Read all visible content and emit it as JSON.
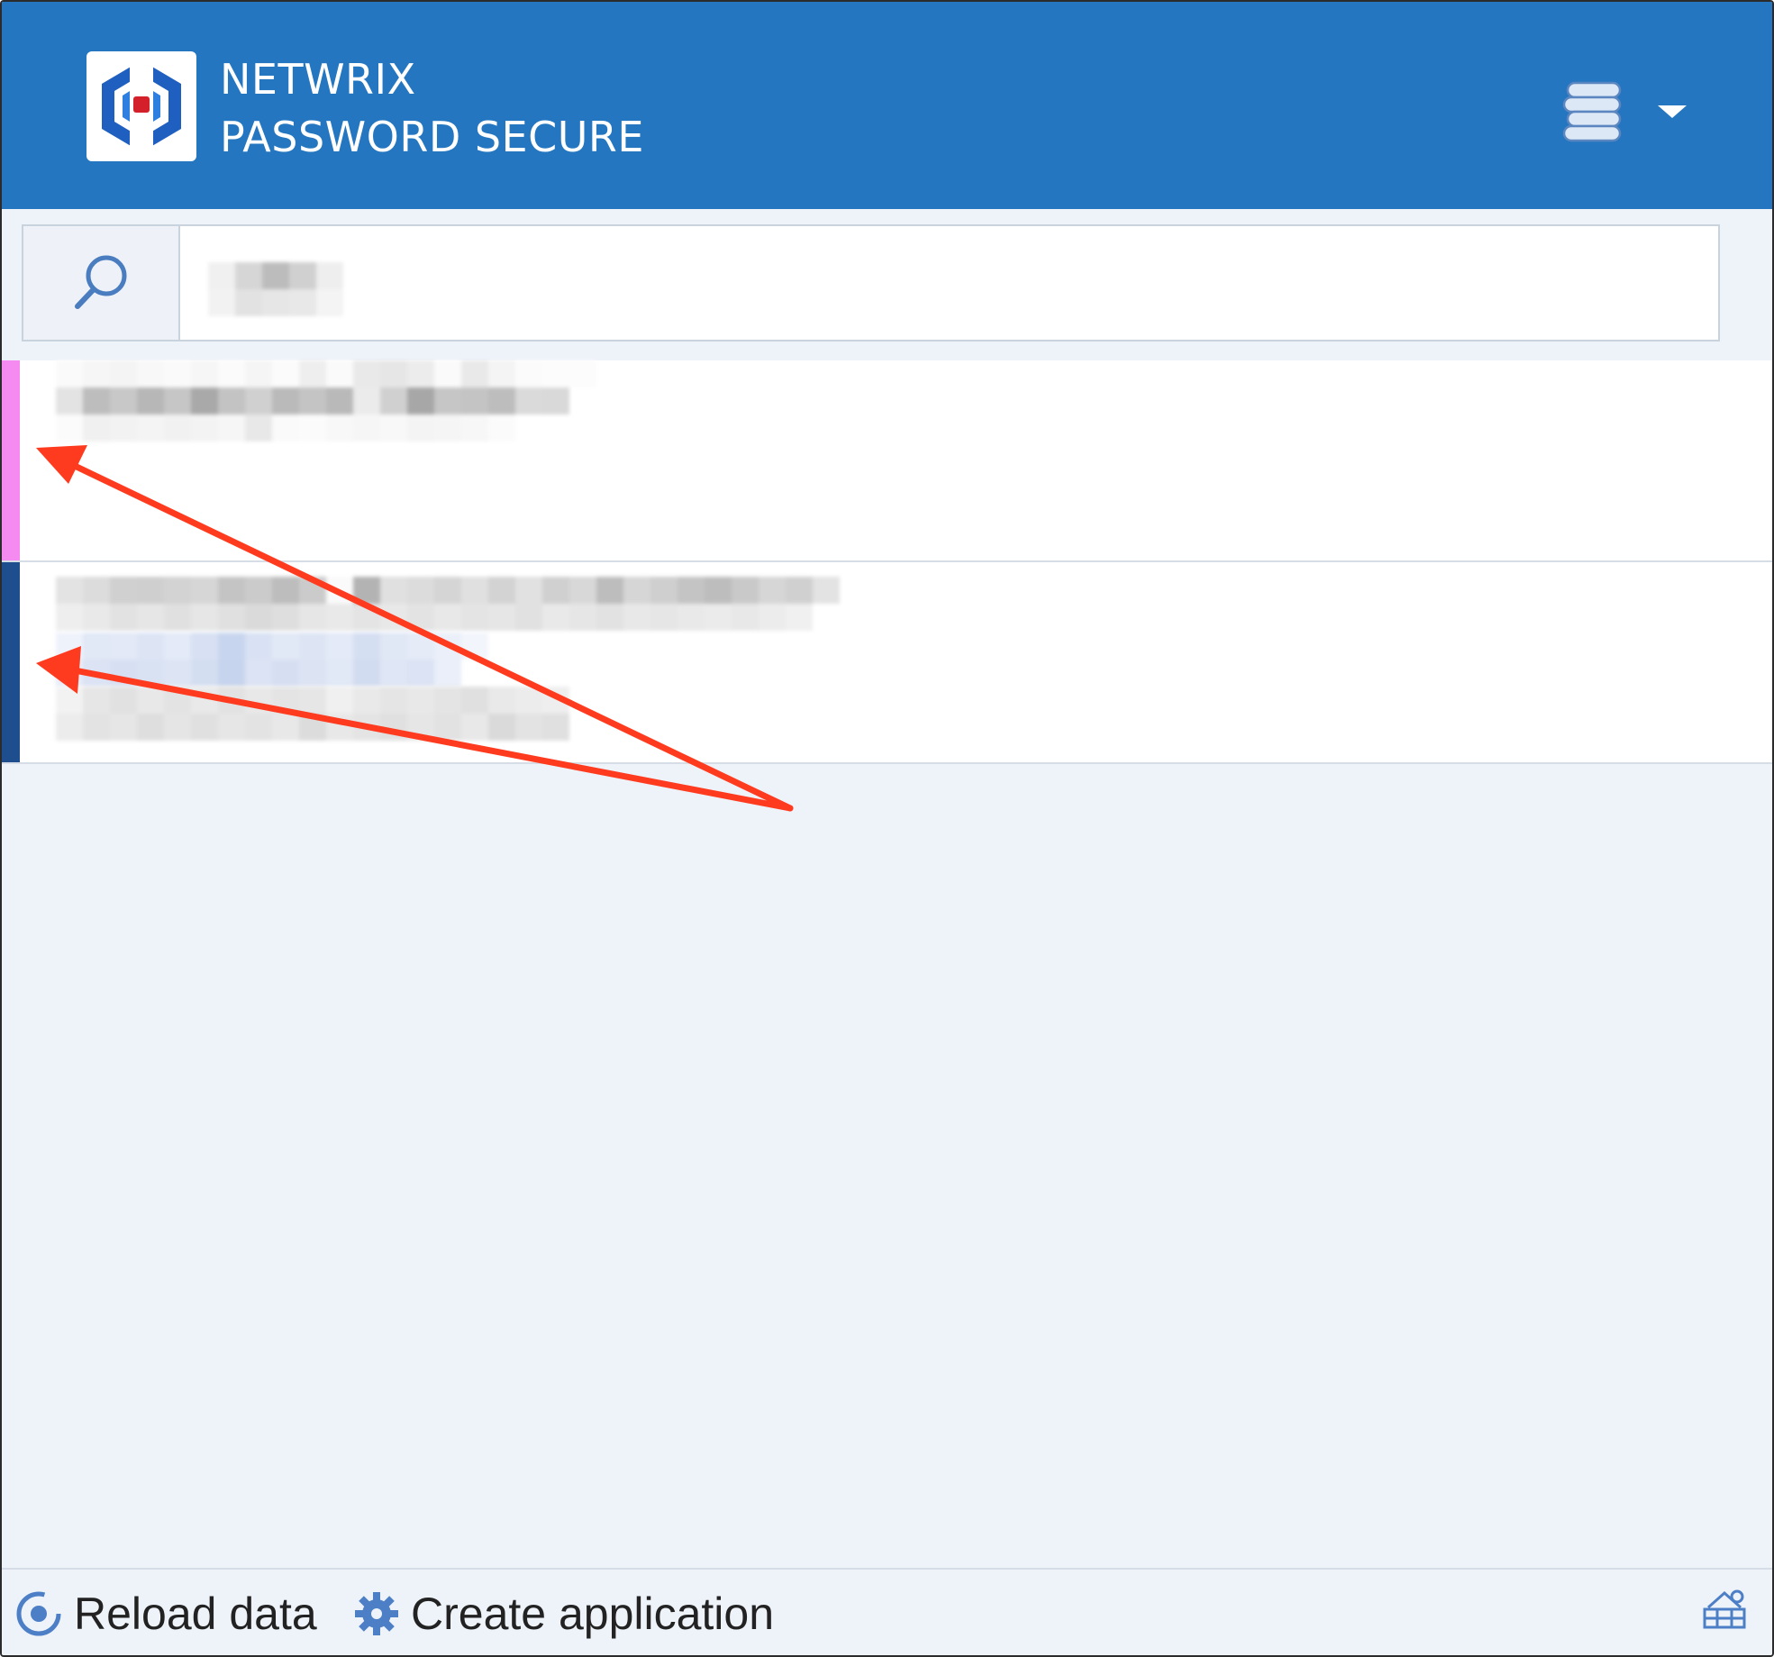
{
  "app": {
    "brand_line1": "NETWRIX",
    "brand_line2": "PASSWORD SECURE"
  },
  "header": {
    "database_menu_icon": "database-icon",
    "database_menu_caret": "chevron-down-icon"
  },
  "search": {
    "icon": "search-icon",
    "value": "",
    "value_redacted": true
  },
  "results": [
    {
      "stripe_color": "#f58af0",
      "content_redacted": true
    },
    {
      "stripe_color": "#1f4e8f",
      "content_redacted": true
    }
  ],
  "footer": {
    "reload_label": "Reload data",
    "reload_icon": "reload-icon",
    "create_label": "Create application",
    "create_icon": "gear-icon",
    "corner_icon": "application-icon"
  },
  "colors": {
    "header_bg": "#2376bf",
    "body_bg": "#eef3fa",
    "annotation_arrow": "#ff3b1f"
  }
}
